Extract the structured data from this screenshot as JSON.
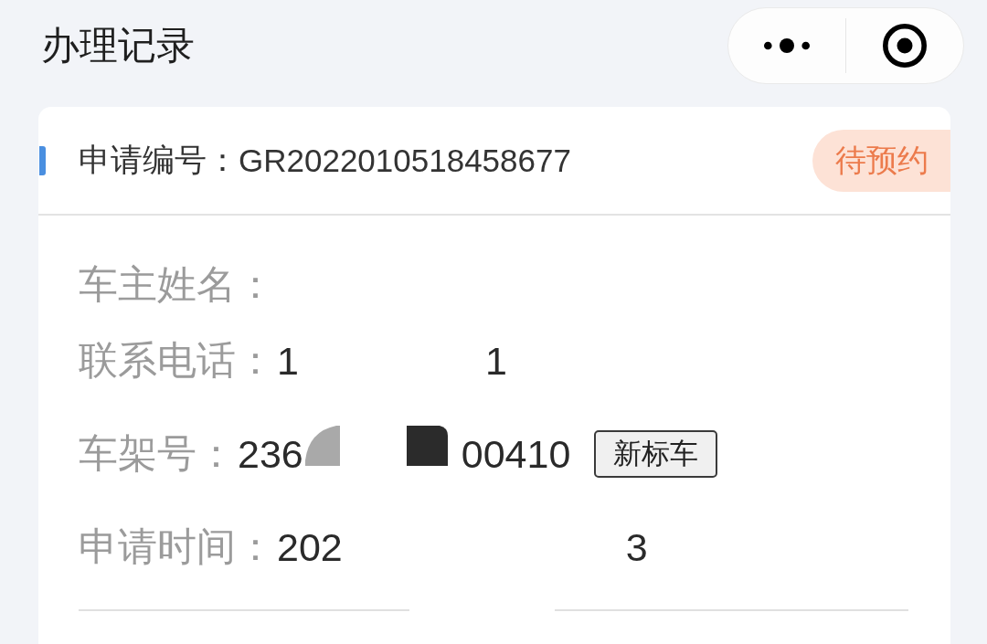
{
  "header": {
    "title": "办理记录"
  },
  "record": {
    "number_label": "申请编号：",
    "number": "GR2022010518458677",
    "status": "待预约",
    "fields": [
      {
        "label": "车主姓名："
      },
      {
        "label": "联系电话：",
        "parts": [
          {
            "kind": "text",
            "text": "1"
          },
          {
            "kind": "blank"
          },
          {
            "kind": "text",
            "text": "1"
          }
        ]
      },
      {
        "label": "车架号：",
        "parts": [
          {
            "kind": "text",
            "text": "236"
          },
          {
            "kind": "blot",
            "color": "#a9a9a9"
          },
          {
            "kind": "blank"
          },
          {
            "kind": "patch",
            "color": "#2b2b2b"
          },
          {
            "kind": "text",
            "text": "00410"
          },
          {
            "kind": "tag",
            "text": "新标车"
          }
        ]
      },
      {
        "label": "申请时间：",
        "parts": [
          {
            "kind": "text",
            "text": "202"
          },
          {
            "kind": "blank"
          },
          {
            "kind": "text",
            "text": "3"
          }
        ]
      }
    ]
  }
}
